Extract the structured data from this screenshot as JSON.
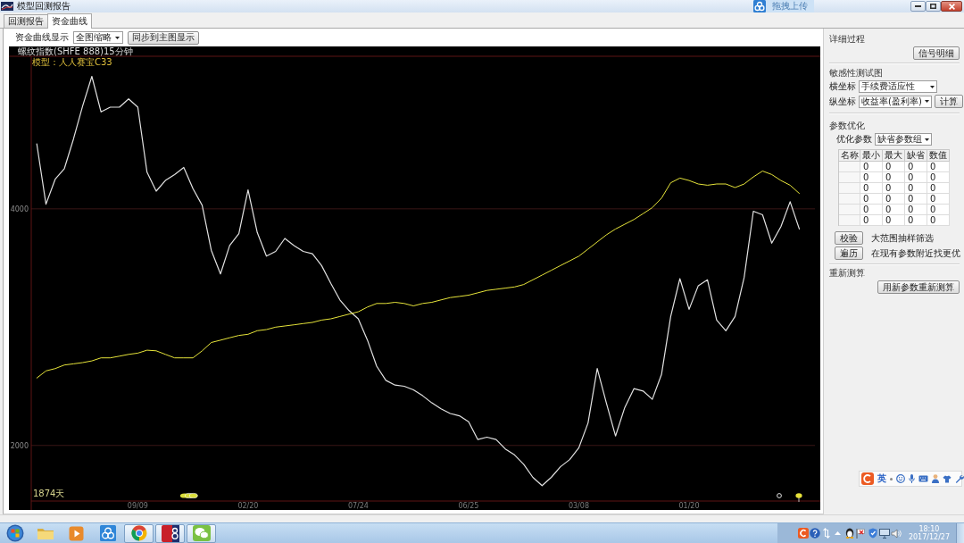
{
  "window": {
    "title": "模型回测报告"
  },
  "upload_button": {
    "label": "拖拽上传"
  },
  "tabs": [
    {
      "label": "回测报告",
      "selected": false
    },
    {
      "label": "资金曲线",
      "selected": true
    }
  ],
  "toolbar": {
    "display_label": "资金曲线显示",
    "display_mode": "全图缩略",
    "sync_button": "同步到主图显示"
  },
  "chart": {
    "instrument": "螺纹指数(SHFE 888)15分钟",
    "model": "模型：人人赛宝C33",
    "duration": "1874天",
    "chart_data": {
      "type": "line",
      "categories": [
        null,
        null,
        null,
        null,
        null,
        null,
        null,
        null,
        null,
        null,
        null,
        "09/09",
        null,
        null,
        null,
        null,
        null,
        null,
        null,
        null,
        null,
        null,
        null,
        "02/20",
        null,
        null,
        null,
        null,
        null,
        null,
        null,
        null,
        null,
        null,
        null,
        "07/24",
        null,
        null,
        null,
        null,
        null,
        null,
        null,
        null,
        null,
        null,
        null,
        "06/25",
        null,
        null,
        null,
        null,
        null,
        null,
        null,
        null,
        null,
        null,
        null,
        "03/08",
        null,
        null,
        null,
        null,
        null,
        null,
        null,
        null,
        null,
        null,
        null,
        "01/20",
        null,
        null,
        null,
        null,
        null,
        null,
        null,
        null,
        null,
        null,
        null,
        null
      ],
      "series": [
        {
          "color": "#e2e2e2",
          "values": [
            4550,
            4040,
            4250,
            4340,
            4590,
            4870,
            5120,
            4820,
            4860,
            4860,
            4930,
            4860,
            4310,
            4150,
            4240,
            4290,
            4350,
            4170,
            4030,
            3650,
            3450,
            3690,
            3790,
            4160,
            3800,
            3600,
            3640,
            3750,
            3690,
            3640,
            3620,
            3520,
            3370,
            3230,
            3140,
            3070,
            2890,
            2670,
            2550,
            2510,
            2500,
            2470,
            2420,
            2360,
            2310,
            2270,
            2250,
            2200,
            2050,
            2070,
            2050,
            1970,
            1920,
            1840,
            1730,
            1660,
            1730,
            1820,
            1880,
            1980,
            2190,
            2650,
            2360,
            2080,
            2320,
            2480,
            2460,
            2390,
            2600,
            3090,
            3410,
            3150,
            3350,
            3400,
            3060,
            2970,
            3090,
            3420,
            3980,
            3950,
            3710,
            3850,
            4060,
            3830
          ]
        },
        {
          "color": "#e6e43a",
          "values": [
            2570,
            2630,
            2650,
            2680,
            2690,
            2700,
            2715,
            2740,
            2740,
            2755,
            2770,
            2780,
            2805,
            2800,
            2770,
            2740,
            2740,
            2740,
            2800,
            2870,
            2890,
            2910,
            2930,
            2940,
            2970,
            2980,
            3000,
            3010,
            3020,
            3030,
            3040,
            3060,
            3070,
            3090,
            3110,
            3130,
            3170,
            3200,
            3200,
            3210,
            3200,
            3180,
            3200,
            3210,
            3230,
            3250,
            3260,
            3270,
            3290,
            3310,
            3320,
            3330,
            3340,
            3360,
            3400,
            3440,
            3480,
            3520,
            3560,
            3600,
            3660,
            3720,
            3780,
            3830,
            3870,
            3910,
            3960,
            4010,
            4090,
            4220,
            4260,
            4240,
            4210,
            4200,
            4210,
            4210,
            4180,
            4210,
            4270,
            4320,
            4290,
            4240,
            4200,
            4130
          ]
        }
      ],
      "ylim": [
        1530,
        5290
      ],
      "yticks": [
        2000,
        4000
      ]
    }
  },
  "side_panel": {
    "detail": {
      "title": "详细过程",
      "button": "信号明细"
    },
    "sensitivity": {
      "title": "敏感性测试图",
      "x_axis_label": "横坐标",
      "x_axis_value": "手续费适应性",
      "y_axis_label": "纵坐标",
      "y_axis_value": "收益率(盈利率)",
      "compute_button": "计算"
    },
    "optimization": {
      "title": "参数优化",
      "param_label": "优化参数",
      "param_value": "缺省参数组",
      "columns": [
        "名称",
        "最小",
        "最大",
        "缺省",
        "数值"
      ],
      "rows": [
        [
          "",
          "0",
          "0",
          "0",
          "0"
        ],
        [
          "",
          "0",
          "0",
          "0",
          "0"
        ],
        [
          "",
          "0",
          "0",
          "0",
          "0"
        ],
        [
          "",
          "0",
          "0",
          "0",
          "0"
        ],
        [
          "",
          "0",
          "0",
          "0",
          "0"
        ],
        [
          "",
          "0",
          "0",
          "0",
          "0"
        ]
      ]
    },
    "actions": [
      {
        "button": "校验",
        "note": "大范围抽样筛选"
      },
      {
        "button": "遍历",
        "note": "在现有参数附近找更优"
      }
    ],
    "recompute": {
      "title": "重新测算",
      "button": "用新参数重新测算"
    }
  },
  "ime_toolbar": {
    "mode": "英"
  },
  "taskbar": {
    "apps": [
      {
        "running": false
      },
      {
        "running": false
      },
      {
        "running": false
      },
      {
        "running": true
      },
      {
        "running": true
      },
      {
        "running": true
      }
    ],
    "clock": {
      "time": "18:10",
      "date": "2017/12/27"
    }
  }
}
